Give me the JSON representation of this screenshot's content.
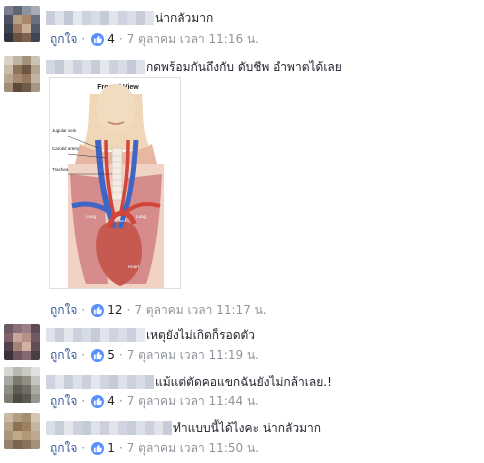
{
  "comments": [
    {
      "text": "น่ากลัวมาก",
      "like_label": "ถูกใจ",
      "reactions": "4",
      "time": "7 ตุลาคม เวลา 11:16 น."
    },
    {
      "text": "กดพร้อมกันถึงกับ ดับชีพ อำพาตได้เลย",
      "like_label": "ถูกใจ",
      "reactions": "12",
      "time": "7 ตุลาคม เวลา 11:17 น."
    },
    {
      "text": "เหตุยังไม่เกิดก็รอดตัว",
      "like_label": "ถูกใจ",
      "reactions": "5",
      "time": "7 ตุลาคม เวลา 11:19 น."
    },
    {
      "text": "แม้แต่ตัดคอแขกฉันยังไม่กล้าเลย.!",
      "like_label": "ถูกใจ",
      "reactions": "4",
      "time": "7 ตุลาคม เวลา 11:44 น."
    },
    {
      "text": "ทำแบบนี้ได้ไงคะ น่ากลัวมาก",
      "like_label": "ถูกใจ",
      "reactions": "1",
      "time": "7 ตุลาคม เวลา 11:50 น."
    }
  ],
  "diagram": {
    "title": "Frontal View",
    "labels": {
      "jugular": "Jugular vein",
      "carotid": "Carotid artery",
      "trachea": "Trachea",
      "lung_left": "Lung",
      "lung_right": "Lung",
      "aorta": "Aorta",
      "heart": "Heart"
    }
  },
  "colors": {
    "link": "#365899",
    "meta": "#90949c",
    "like_icon": "#5890ff"
  }
}
